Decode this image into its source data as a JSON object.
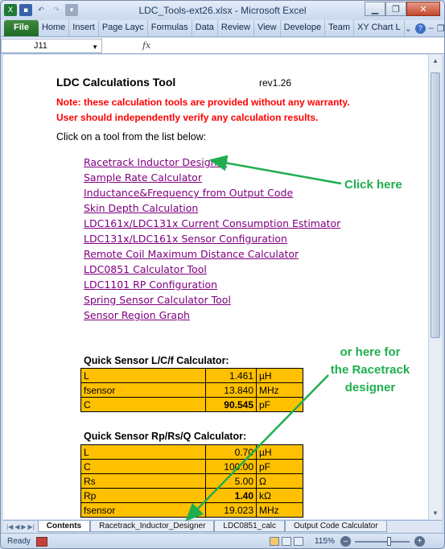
{
  "window": {
    "title": "LDC_Tools-ext26.xlsx - Microsoft Excel",
    "qat_icons": [
      "excel-logo-icon",
      "save-icon",
      "undo-icon",
      "redo-icon"
    ]
  },
  "ribbon": {
    "file_tab": "File",
    "tabs": [
      "Home",
      "Insert",
      "Page Layc",
      "Formulas",
      "Data",
      "Review",
      "View",
      "Develope",
      "Team",
      "XY Chart L"
    ]
  },
  "formula_bar": {
    "name_box": "J11",
    "fx": "fx",
    "formula": ""
  },
  "sheet": {
    "title": "LDC Calculations Tool",
    "revision": "rev1.26",
    "warning_line1": "Note: these calculation tools are provided without any warranty.",
    "warning_line2": "User should independently verify any calculation results.",
    "instruction": "Click on a tool from the list below:",
    "links": [
      "Racetrack Inductor Designer",
      "Sample Rate Calculator",
      "Inductance&Frequency from Output Code",
      "Skin Depth Calculation",
      "LDC161x/LDC131x Current Consumption Estimator",
      "LDC131x/LDC161x Sensor Configuration",
      "Remote Coil Maximum Distance Calculator",
      "LDC0851 Calculator Tool",
      "LDC1101 RP Configuration",
      "Spring Sensor Calculator Tool",
      "Sensor Region Graph"
    ],
    "lcf_title": "Quick Sensor L/C/f Calculator:",
    "lcf_rows": [
      {
        "label": "L",
        "value": "1.461",
        "unit": "µH",
        "bold": false
      },
      {
        "label": "fsensor",
        "value": "13.840",
        "unit": "MHz",
        "bold": false
      },
      {
        "label": "C",
        "value": "90.545",
        "unit": "pF",
        "bold": true
      }
    ],
    "rprs_title": "Quick Sensor Rp/Rs/Q Calculator:",
    "rprs_rows": [
      {
        "label": "L",
        "value": "0.70",
        "unit": "µH",
        "bold": false
      },
      {
        "label": "C",
        "value": "100.00",
        "unit": "pF",
        "bold": false
      },
      {
        "label": "Rs",
        "value": "5.00",
        "unit": "Ω",
        "bold": false
      },
      {
        "label": "Rp",
        "value": "1.40",
        "unit": "kΩ",
        "bold": true
      },
      {
        "label": "fsensor",
        "value": "19.023",
        "unit": "MHz",
        "bold": false
      }
    ]
  },
  "callouts": {
    "click_here": "Click here",
    "or_here_1": "or here for",
    "or_here_2": "the Racetrack",
    "or_here_3": "designer",
    "color": "#1fae4e"
  },
  "sheet_tabs": {
    "tabs": [
      "Contents",
      "Racetrack_Inductor_Designer",
      "LDC0851_calc",
      "Output Code Calculator"
    ],
    "active": "Contents"
  },
  "status_bar": {
    "ready": "Ready",
    "zoom": "115%",
    "zoom_fraction": 0.6
  }
}
